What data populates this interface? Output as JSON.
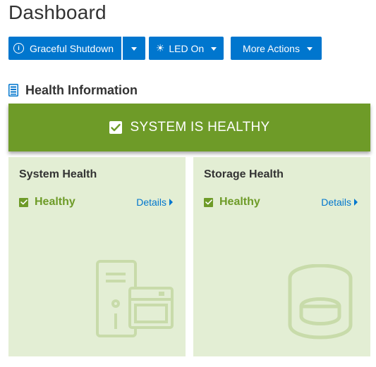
{
  "page": {
    "title": "Dashboard"
  },
  "toolbar": {
    "shutdown_label": "Graceful Shutdown",
    "led_label": "LED On",
    "more_label": "More Actions"
  },
  "health": {
    "section_title": "Health Information",
    "banner_text": "SYSTEM IS HEALTHY",
    "cards": [
      {
        "title": "System Health",
        "status": "Healthy",
        "link": "Details"
      },
      {
        "title": "Storage Health",
        "status": "Healthy",
        "link": "Details"
      }
    ]
  },
  "colors": {
    "accent": "#0076ce",
    "healthy": "#6e9b28",
    "card_bg": "#e3eed4"
  },
  "icons": {
    "info": "info-circle-icon",
    "led": "sun-icon",
    "section": "server-list-icon",
    "check": "checkbox-checked-icon",
    "system_illustration": "server-icon",
    "storage_illustration": "disk-cylinder-icon"
  }
}
